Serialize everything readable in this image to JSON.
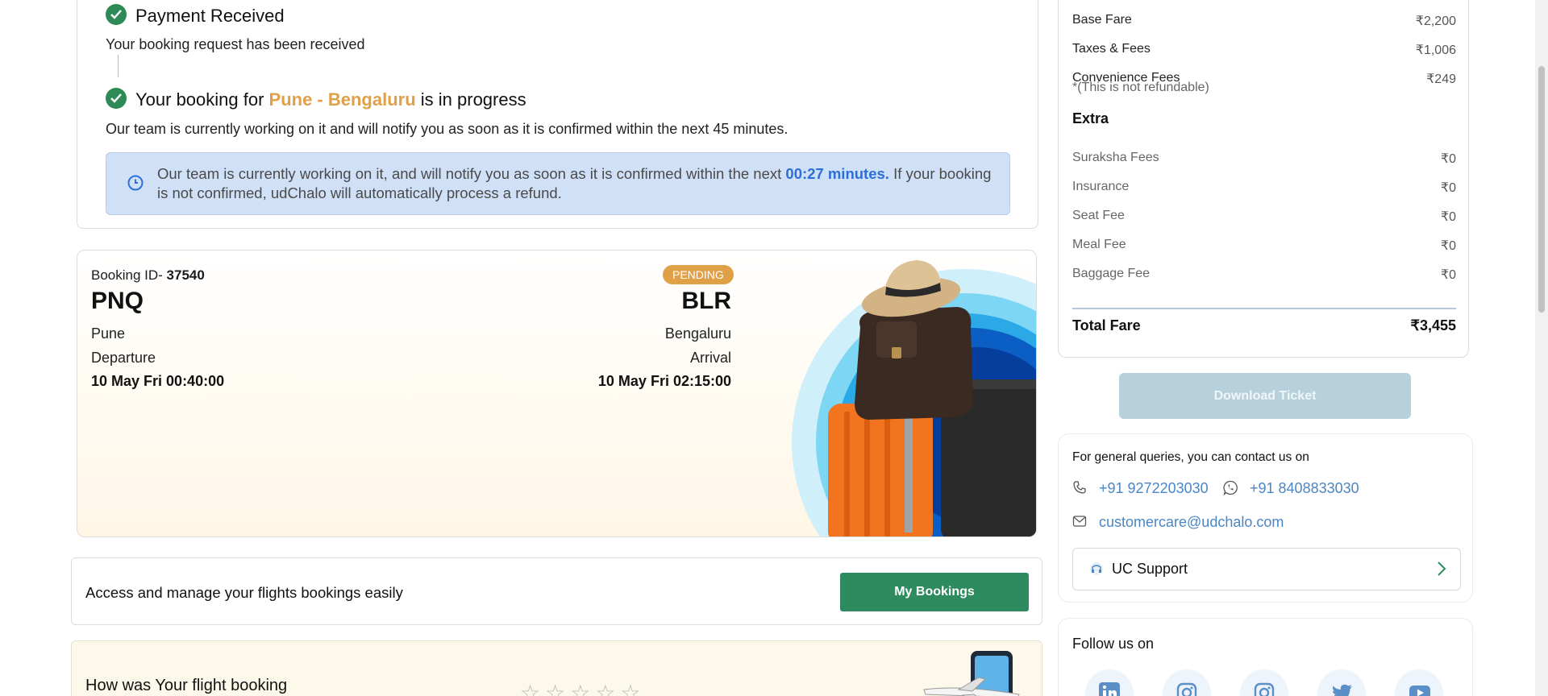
{
  "status": {
    "payment_title": "Payment Received",
    "payment_sub": "Your booking request has been received",
    "progress_prefix": "Your booking for ",
    "progress_route": "Pune - Bengaluru",
    "progress_suffix": " is in progress",
    "progress_sub": "Our team is currently working on it and will notify you as soon as it is confirmed within the next 45 minutes.",
    "info_prefix": "Our team is currently working on it, and will notify you as soon as it is confirmed within the next ",
    "info_time": "00:27 minutes.",
    "info_suffix": " If your booking is not confirmed, udChalo will automatically process a refund."
  },
  "booking": {
    "id_label": "Booking ID- ",
    "id_value": "37540",
    "status_badge": "PENDING",
    "from_code": "PNQ",
    "to_code": "BLR",
    "from_city": "Pune",
    "to_city": "Bengaluru",
    "departure_label": "Departure",
    "arrival_label": "Arrival",
    "departure_time": "10 May Fri 00:40:00",
    "arrival_time": "10 May Fri 02:15:00"
  },
  "manage": {
    "text": "Access and manage your flights bookings easily",
    "button": "My Bookings"
  },
  "feedback": {
    "text": "How was Your flight booking",
    "stars": "☆☆☆☆☆"
  },
  "fare": {
    "base_label": "Base Fare",
    "base_value": "₹2,200",
    "taxes_label": "Taxes & Fees",
    "taxes_value": "₹1,006",
    "conv_label": "Convenience Fees",
    "conv_value": "₹249",
    "conv_note": "*(This is not refundable)",
    "extra_heading": "Extra",
    "suraksha_label": "Suraksha Fees",
    "suraksha_value": "₹0",
    "insurance_label": "Insurance",
    "insurance_value": "₹0",
    "seat_label": "Seat Fee",
    "seat_value": "₹0",
    "meal_label": "Meal Fee",
    "meal_value": "₹0",
    "baggage_label": "Baggage Fee",
    "baggage_value": "₹0",
    "total_label": "Total Fare",
    "total_value": "₹3,455"
  },
  "download_button": "Download Ticket",
  "contact": {
    "title": "For general queries, you can contact us on",
    "phone": "+91 9272203030",
    "whatsapp": "+91 8408833030",
    "email": "customercare@udchalo.com",
    "support_label": "UC Support"
  },
  "follow": {
    "title": "Follow us on",
    "networks": [
      "linkedin-icon",
      "instagram-icon",
      "instagram-icon",
      "twitter-icon",
      "youtube-icon"
    ]
  },
  "colors": {
    "accent_green": "#2e8b5f",
    "accent_orange": "#e0a048",
    "info_blue": "#2d6fd6",
    "link_blue": "#4a86c5"
  }
}
